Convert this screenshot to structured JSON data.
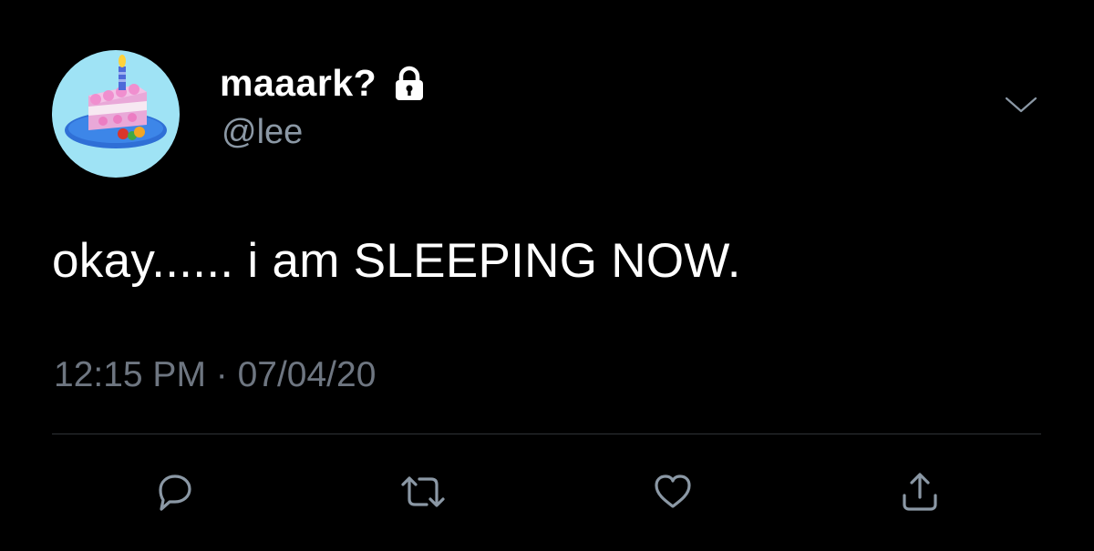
{
  "tweet": {
    "display_name": "maaark?",
    "handle": "@lee",
    "text": "okay...... i am SLEEPING NOW.",
    "timestamp": "12:15 PM · 07/04/20",
    "protected": true
  },
  "icons": {
    "lock": "lock-icon",
    "caret": "chevron-down-icon",
    "reply": "reply-icon",
    "retweet": "retweet-icon",
    "like": "heart-icon",
    "share": "share-icon"
  },
  "colors": {
    "background": "#000000",
    "text": "#ffffff",
    "handle": "#8b98a5",
    "timestamp": "#6e7681",
    "icon": "#8b98a5",
    "divider": "#2f3336",
    "avatar_bg": "#9fe3f5"
  }
}
